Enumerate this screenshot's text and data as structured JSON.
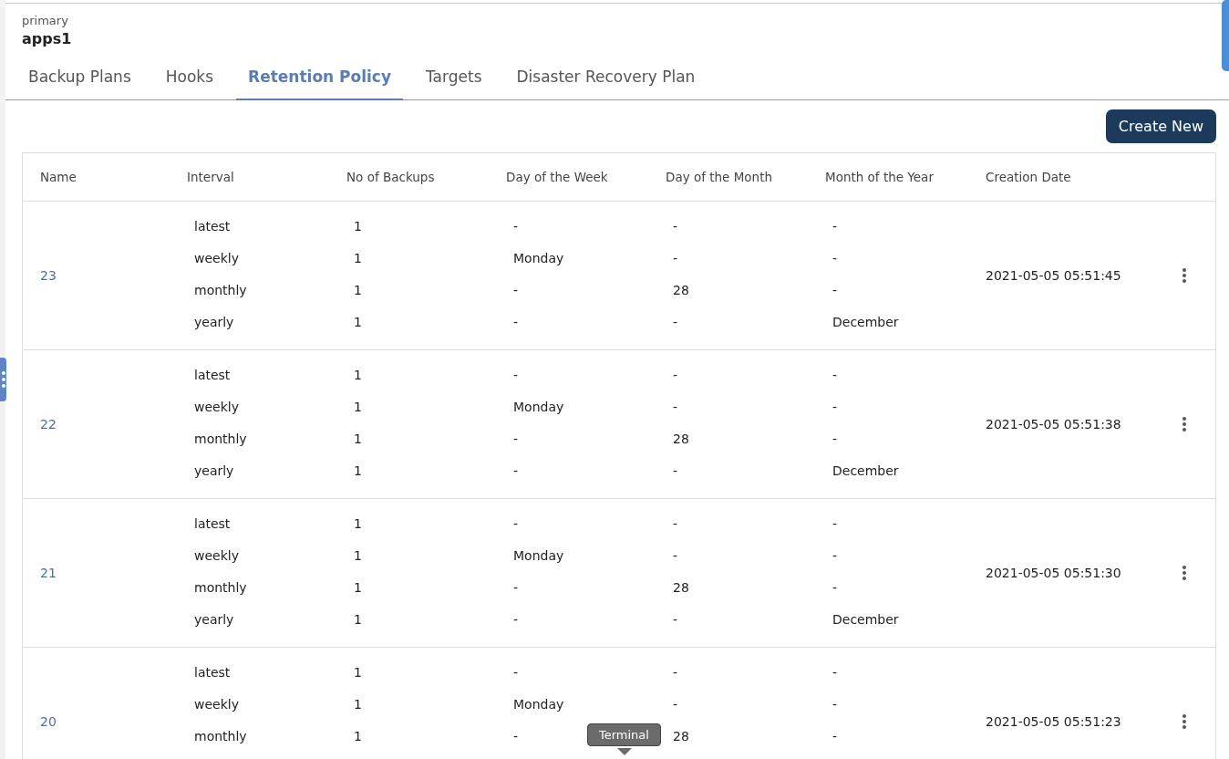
{
  "header": {
    "cluster": "primary",
    "namespace": "apps1"
  },
  "tabs": [
    {
      "label": "Backup Plans",
      "selected": false
    },
    {
      "label": "Hooks",
      "selected": false
    },
    {
      "label": "Retention Policy",
      "selected": true
    },
    {
      "label": "Targets",
      "selected": false
    },
    {
      "label": "Disaster Recovery Plan",
      "selected": false
    }
  ],
  "create_button": "Create New",
  "table": {
    "columns": [
      "Name",
      "Interval",
      "No of Backups",
      "Day of the Week",
      "Day of the Month",
      "Month of the Year",
      "Creation Date"
    ],
    "rows": [
      {
        "name": "23",
        "creation_date": "2021-05-05 05:51:45",
        "intervals": [
          [
            "latest",
            "1",
            "-",
            "-",
            "-"
          ],
          [
            "weekly",
            "1",
            "Monday",
            "-",
            "-"
          ],
          [
            "monthly",
            "1",
            "-",
            "28",
            "-"
          ],
          [
            "yearly",
            "1",
            "-",
            "-",
            "December"
          ]
        ]
      },
      {
        "name": "22",
        "creation_date": "2021-05-05 05:51:38",
        "intervals": [
          [
            "latest",
            "1",
            "-",
            "-",
            "-"
          ],
          [
            "weekly",
            "1",
            "Monday",
            "-",
            "-"
          ],
          [
            "monthly",
            "1",
            "-",
            "28",
            "-"
          ],
          [
            "yearly",
            "1",
            "-",
            "-",
            "December"
          ]
        ]
      },
      {
        "name": "21",
        "creation_date": "2021-05-05 05:51:30",
        "intervals": [
          [
            "latest",
            "1",
            "-",
            "-",
            "-"
          ],
          [
            "weekly",
            "1",
            "Monday",
            "-",
            "-"
          ],
          [
            "monthly",
            "1",
            "-",
            "28",
            "-"
          ],
          [
            "yearly",
            "1",
            "-",
            "-",
            "December"
          ]
        ]
      },
      {
        "name": "20",
        "creation_date": "2021-05-05 05:51:23",
        "intervals": [
          [
            "latest",
            "1",
            "-",
            "-",
            "-"
          ],
          [
            "weekly",
            "1",
            "Monday",
            "-",
            "-"
          ],
          [
            "monthly",
            "1",
            "-",
            "28",
            "-"
          ]
        ]
      }
    ]
  },
  "tooltip": "Terminal"
}
